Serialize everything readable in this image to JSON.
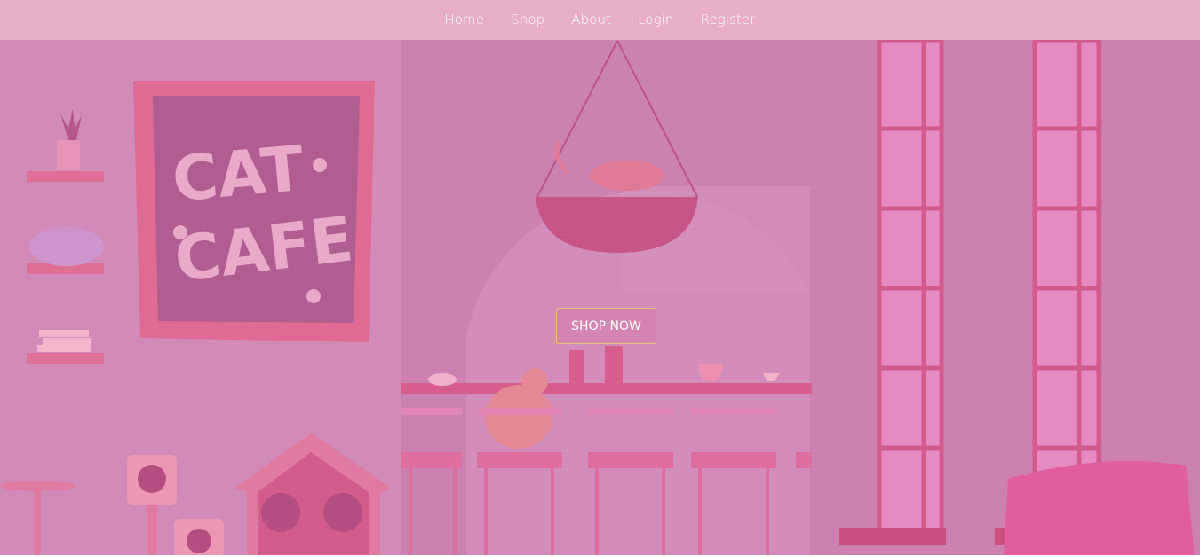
{
  "nav": {
    "items": [
      {
        "label": "Home"
      },
      {
        "label": "Shop"
      },
      {
        "label": "About"
      },
      {
        "label": "Login"
      },
      {
        "label": "Register"
      }
    ]
  },
  "hero": {
    "sign_line1": "CAT",
    "sign_line2": "CAFE",
    "cta_label": "SHOP NOW"
  },
  "colors": {
    "navbar_bg": "#e8aec3",
    "hero_bg": "#d086b5",
    "cta_border": "#e8c27a"
  }
}
